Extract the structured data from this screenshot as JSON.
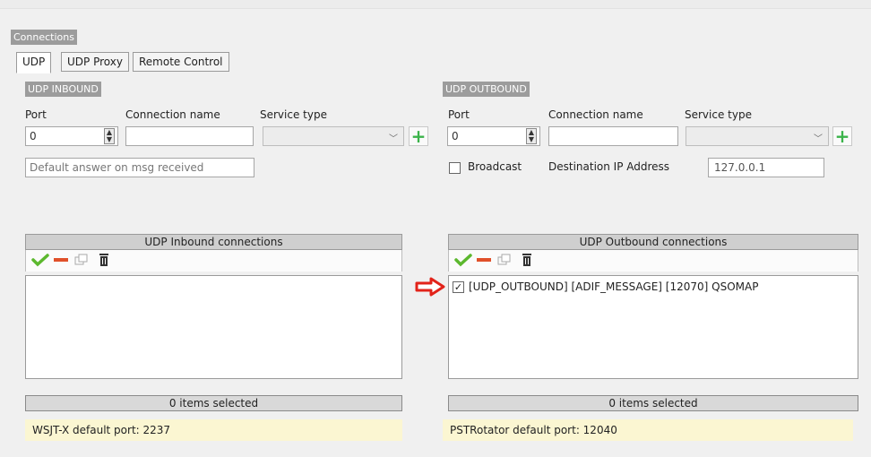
{
  "connections_title": "Connections",
  "tabs": [
    {
      "label": "UDP",
      "active": true
    },
    {
      "label": "UDP Proxy",
      "active": false
    },
    {
      "label": "Remote Control",
      "active": false
    }
  ],
  "inbound": {
    "group_title": "UDP INBOUND",
    "port_label": "Port",
    "port_value": "0",
    "connection_name_label": "Connection name",
    "connection_name_value": "",
    "service_type_label": "Service type",
    "service_type_value": "",
    "default_answer_placeholder": "Default answer on msg received",
    "list_header": "UDP Inbound connections",
    "items": [],
    "status": "0 items selected",
    "note": "WSJT-X default port: 2237"
  },
  "outbound": {
    "group_title": "UDP OUTBOUND",
    "port_label": "Port",
    "port_value": "0",
    "connection_name_label": "Connection name",
    "connection_name_value": "",
    "service_type_label": "Service type",
    "service_type_value": "",
    "broadcast_label": "Broadcast",
    "broadcast_checked": false,
    "destination_ip_label": "Destination IP Address",
    "destination_ip_value": "127.0.0.1",
    "list_header": "UDP Outbound connections",
    "items": [
      {
        "checked": true,
        "text": "[UDP_OUTBOUND] [ADIF_MESSAGE] [12070] QSOMAP"
      }
    ],
    "status": "0 items selected",
    "note": "PSTRotator default port: 12040"
  },
  "icons": {
    "spin_up": "▲",
    "spin_down": "▼",
    "combo_arrow": "﹀",
    "add": "+",
    "check_mark": "✓",
    "arrow": "➡"
  },
  "colors": {
    "group_title_bg": "#9c9c9c",
    "add_icon": "#3bb34a",
    "enable_icon": "#5cb82e",
    "remove_icon": "#e0502a",
    "annotation_arrow": "#e2231a",
    "note_bg": "#fbf6d2"
  }
}
